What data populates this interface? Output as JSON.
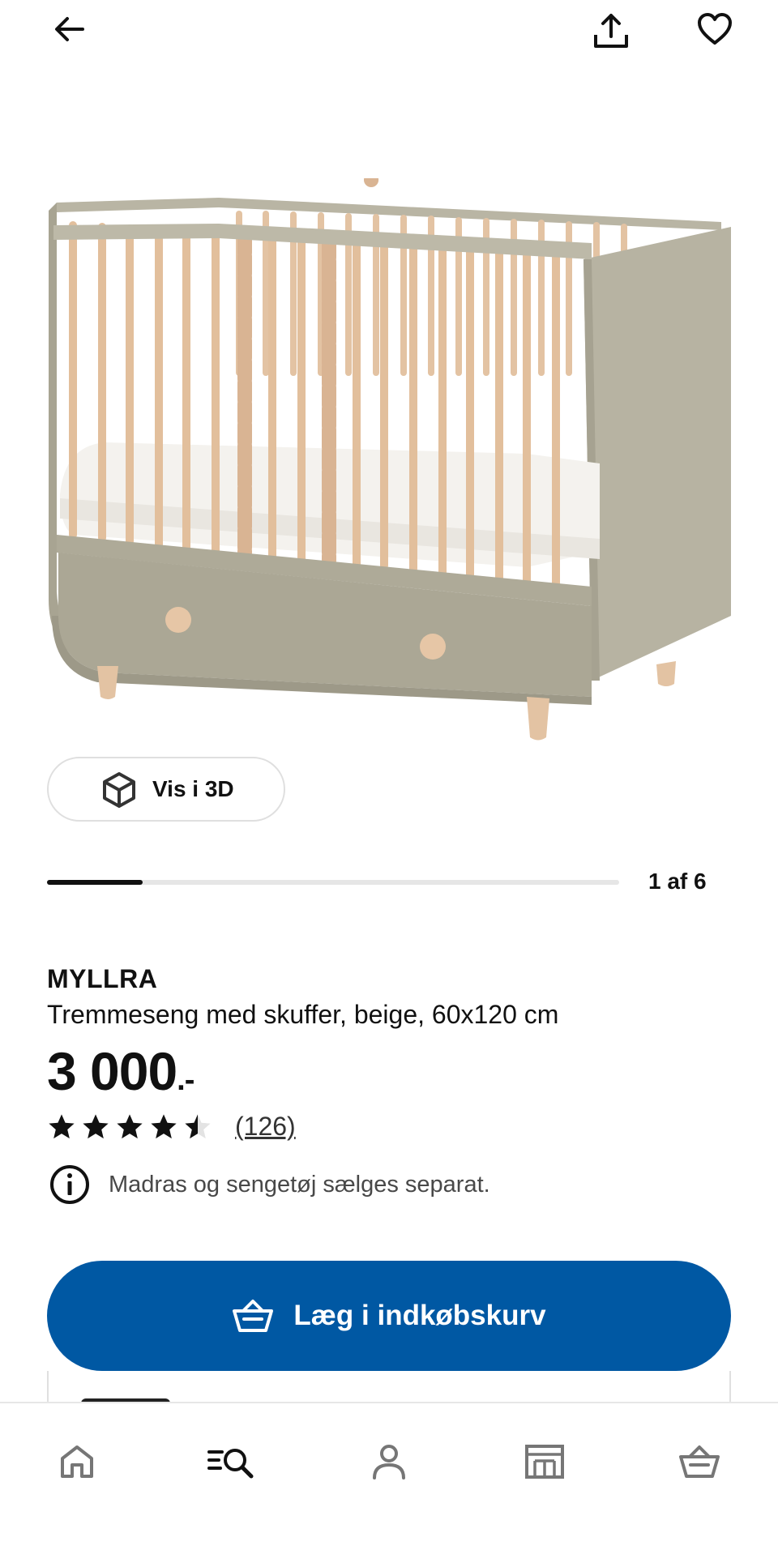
{
  "header": {
    "back_icon": "arrow-left-icon",
    "share_icon": "share-icon",
    "favourite_icon": "heart-icon"
  },
  "gallery": {
    "image_alt": "MYLLRA tremmeseng med skuffer",
    "view_3d_label": "Vis i 3D",
    "counter": "1 af 6",
    "progress_fraction": 0.167
  },
  "product": {
    "name": "MYLLRA",
    "description": "Tremmeseng med skuffer, beige, 60x120 cm",
    "price_main": "3 000",
    "price_suffix": ".-",
    "rating": 4.5,
    "rating_max": 5,
    "reviews": "(126)",
    "info_note": "Madras og sengetøj sælges separat."
  },
  "actions": {
    "add_to_cart": "Læg i indkøbskurv"
  },
  "tabbar": {
    "items": [
      {
        "icon": "home-icon"
      },
      {
        "icon": "search-icon"
      },
      {
        "icon": "profile-icon"
      },
      {
        "icon": "store-icon"
      },
      {
        "icon": "basket-icon"
      }
    ]
  },
  "colors": {
    "accent_blue": "#0058a3",
    "crib_beige": "#b9b5a4",
    "wood": "#e0bfa0"
  }
}
